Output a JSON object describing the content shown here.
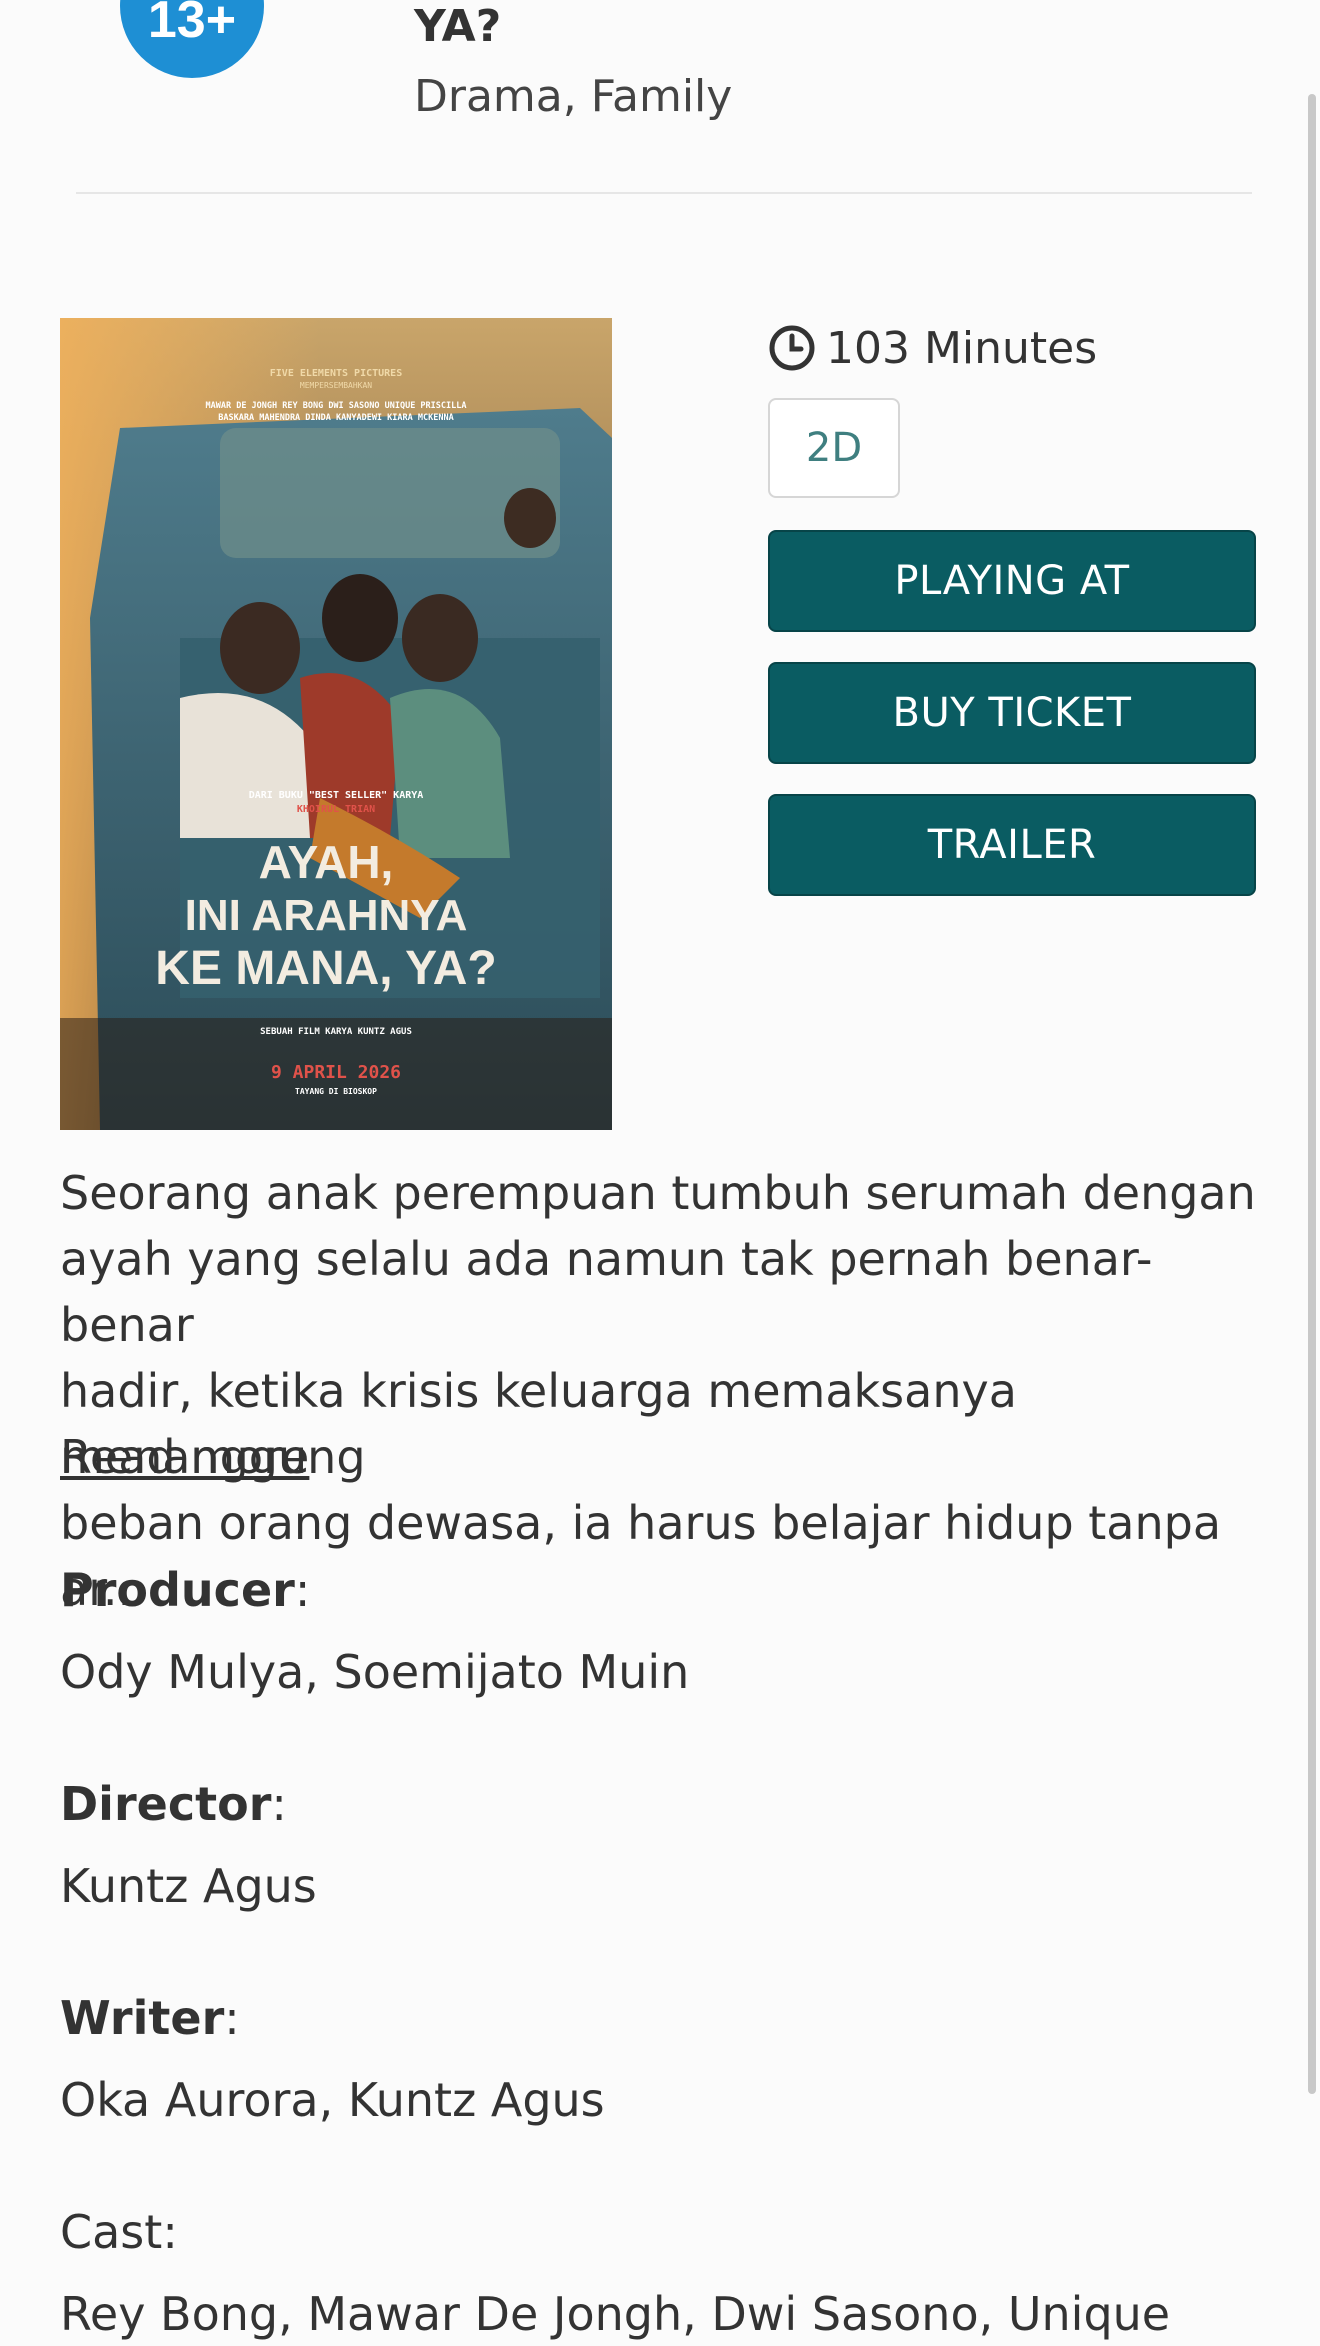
{
  "header": {
    "age_rating": "13+",
    "title_tail": "YA?",
    "genres": "Drama, Family"
  },
  "poster": {
    "studio": "FIVE ELEMENTS PICTURES",
    "presents": "MEMPERSEMBAHKAN",
    "cast_line1": "MAWAR DE JONGH  REY BONG  DWI SASONO  UNIQUE PRISCILLA",
    "cast_line2": "BASKARA MAHENDRA  DINDA KANYADEWI  KIARA MCKENNA",
    "book_credit": "DARI BUKU \"BEST SELLER\" KARYA",
    "author": "KHOIRUL TRIAN",
    "title_line1": "AYAH,",
    "title_line2": "INI ARAHNYA",
    "title_line3": "KE MANA, YA?",
    "film_by": "SEBUAH FILM KARYA KUNTZ AGUS",
    "release_date": "9 APRIL 2026",
    "release_note": "TAYANG DI BIOSKOP"
  },
  "info": {
    "runtime": "103 Minutes",
    "format": "2D"
  },
  "buttons": {
    "playing_at": "PLAYING AT",
    "buy_ticket": "BUY TICKET",
    "trailer": "TRAILER"
  },
  "synopsis": {
    "line1": "Seorang anak perempuan tumbuh serumah dengan",
    "line2": "ayah yang selalu ada namun tak pernah benar-benar",
    "line3": "hadir, ketika krisis keluarga memaksanya menanggung",
    "line4": "beban orang dewasa, ia harus belajar hidup tanpa ar..",
    "read_more": "Read more"
  },
  "credits": {
    "producer_label": "Producer",
    "producer": "Ody Mulya, Soemijato Muin",
    "director_label": "Director",
    "director": "Kuntz Agus",
    "writer_label": "Writer",
    "writer": "Oka Aurora, Kuntz Agus",
    "cast_label": "Cast",
    "cast": "Rey Bong, Mawar De Jongh, Dwi Sasono, Unique"
  },
  "colors": {
    "button_bg": "#0a5c62",
    "age_badge": "#1e8fd4",
    "format_text": "#3f7f80"
  },
  "icons": {
    "runtime": "clock-icon"
  }
}
